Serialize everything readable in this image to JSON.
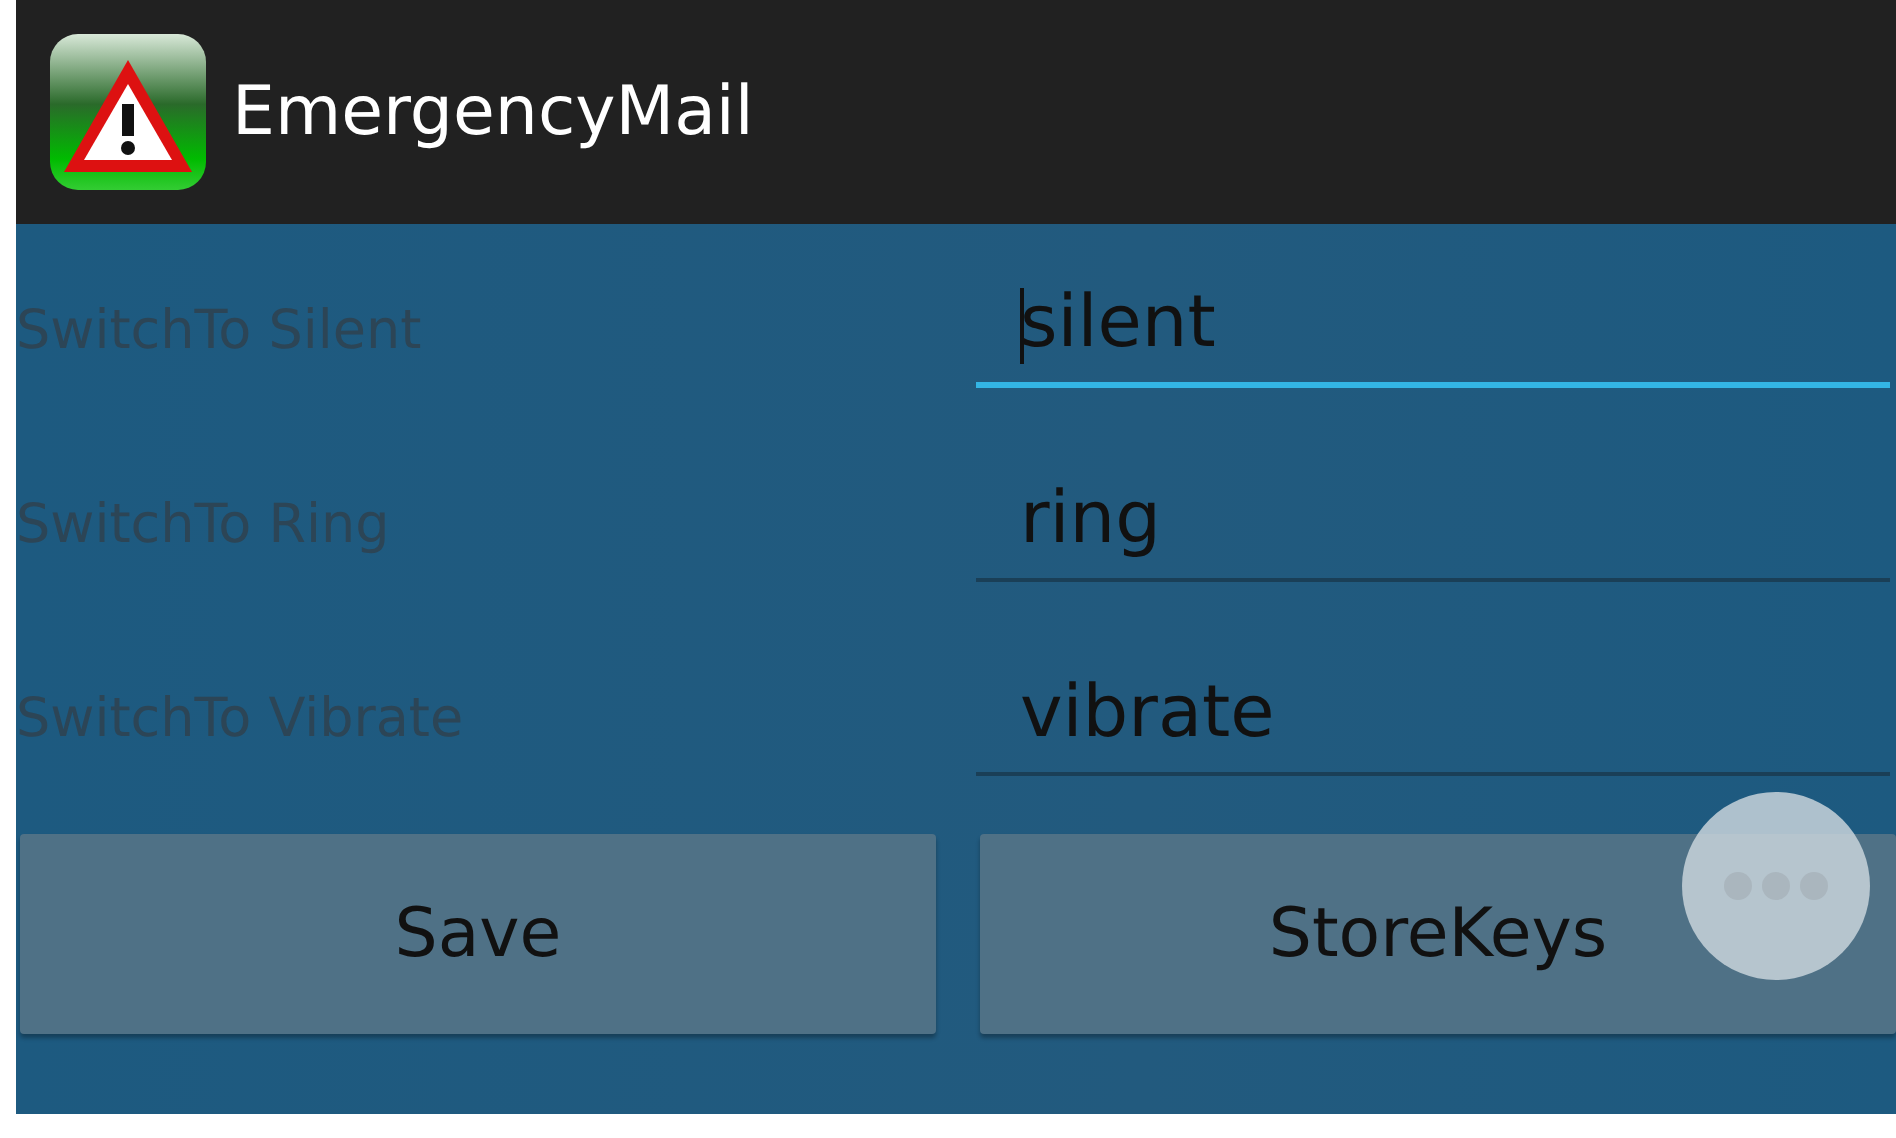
{
  "action_bar": {
    "title": "EmergencyMail"
  },
  "rows": [
    {
      "label": "SwitchTo Silent",
      "value": "silent",
      "focused": true
    },
    {
      "label": "SwitchTo Ring",
      "value": "ring",
      "focused": false
    },
    {
      "label": "SwitchTo Vibrate",
      "value": "vibrate",
      "focused": false
    }
  ],
  "buttons": [
    "Save",
    "StoreKeys"
  ]
}
